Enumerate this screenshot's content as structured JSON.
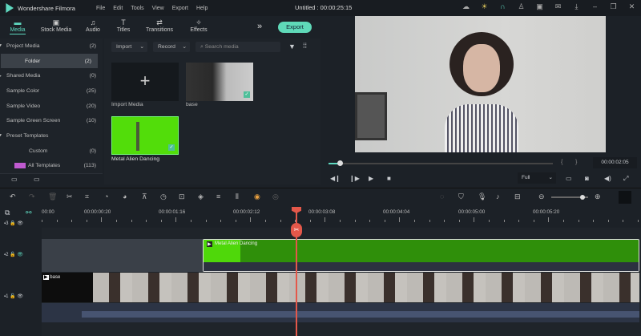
{
  "app": {
    "name": "Wondershare Filmora",
    "project_title": "Untitled : 00:00:25:15"
  },
  "menu": [
    "File",
    "Edit",
    "Tools",
    "View",
    "Export",
    "Help"
  ],
  "tabs": [
    {
      "label": "Media",
      "icon": "folder-icon"
    },
    {
      "label": "Stock Media",
      "icon": "image-icon"
    },
    {
      "label": "Audio",
      "icon": "music-icon"
    },
    {
      "label": "Titles",
      "icon": "text-icon"
    },
    {
      "label": "Transitions",
      "icon": "transition-icon"
    },
    {
      "label": "Effects",
      "icon": "effects-icon"
    }
  ],
  "export_label": "Export",
  "sidebar": [
    {
      "label": "Project Media",
      "count": "(2)",
      "arrow": "▼",
      "indent": 1
    },
    {
      "label": "Folder",
      "count": "(2)",
      "indent": 2,
      "selected": true
    },
    {
      "label": "Shared Media",
      "count": "(0)",
      "arrow": "▶",
      "indent": 1
    },
    {
      "label": "Sample Color",
      "count": "(25)",
      "indent": 1
    },
    {
      "label": "Sample Video",
      "count": "(20)",
      "indent": 1
    },
    {
      "label": "Sample Green Screen",
      "count": "(10)",
      "indent": 1
    },
    {
      "label": "Preset Templates",
      "count": "",
      "arrow": "▼",
      "indent": 1
    },
    {
      "label": "Custom",
      "count": "(0)",
      "indent": 2
    },
    {
      "label": "All Templates",
      "count": "(113)",
      "indent": 2
    }
  ],
  "media": {
    "import": "Import",
    "record": "Record",
    "search_placeholder": "Search media",
    "items": [
      "Import Media",
      "base",
      "Metal Alien Dancing"
    ]
  },
  "preview": {
    "timecode": "00:00:02:05",
    "quality": "Full",
    "progress": 0.05
  },
  "ruler": [
    "00:00",
    "00:00:00:20",
    "00:00:01:16",
    "00:00:02:12",
    "00:00:03:08",
    "00:00:04:04",
    "00:00:05:00",
    "00:00:05:20"
  ],
  "tracks": {
    "green_clip": "Metal Alien Dancing",
    "base_clip": "base",
    "v3": "3",
    "v2": "2",
    "v1": "1"
  },
  "colors": {
    "accent": "#5fd9c0",
    "playhead": "#e4584a",
    "green": "#3fbf0a"
  }
}
